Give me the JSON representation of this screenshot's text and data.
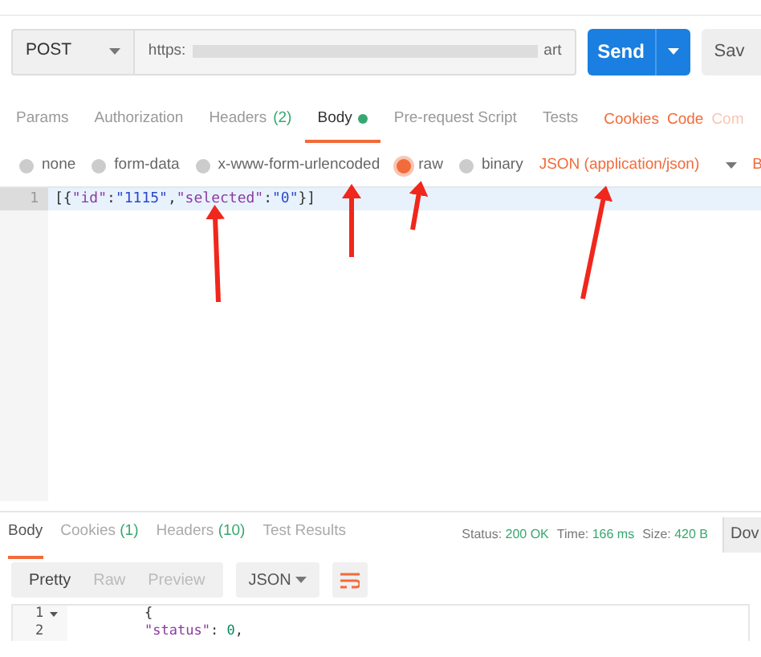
{
  "request": {
    "method": "POST",
    "url_start": "https:",
    "url_end": "art",
    "send": "Send",
    "save": "Sav"
  },
  "tabs": [
    {
      "label": "Params",
      "selected": false,
      "dot": false
    },
    {
      "label": "Authorization",
      "selected": false,
      "dot": false
    },
    {
      "label": "Headers",
      "count": "(2)",
      "selected": false,
      "dot": false
    },
    {
      "label": "Body",
      "selected": true,
      "dot": true
    },
    {
      "label": "Pre-request Script",
      "selected": false,
      "dot": false
    },
    {
      "label": "Tests",
      "selected": false,
      "dot": false
    }
  ],
  "links": [
    {
      "label": "Cookies",
      "disabled": false
    },
    {
      "label": "Code",
      "disabled": false
    },
    {
      "label": "Com",
      "disabled": true
    }
  ],
  "body_types": [
    {
      "label": "none",
      "selected": false
    },
    {
      "label": "form-data",
      "selected": false
    },
    {
      "label": "x-www-form-urlencoded",
      "selected": false
    },
    {
      "label": "raw",
      "selected": true
    },
    {
      "label": "binary",
      "selected": false
    }
  ],
  "content_type": "JSON (application/json)",
  "beautify": "B",
  "editor": [
    {
      "number": "1",
      "tokens": [
        {
          "kind": "punct",
          "text": "[{"
        },
        {
          "kind": "key",
          "text": "\"id\""
        },
        {
          "kind": "punct",
          "text": ":"
        },
        {
          "kind": "string",
          "text": "\"1115\""
        },
        {
          "kind": "punct",
          "text": ","
        },
        {
          "kind": "key",
          "text": "\"selected\""
        },
        {
          "kind": "punct",
          "text": ":"
        },
        {
          "kind": "string",
          "text": "\"0\""
        },
        {
          "kind": "punct",
          "text": "}]"
        }
      ]
    }
  ],
  "response": {
    "tabs": [
      {
        "label": "Body",
        "selected": true
      },
      {
        "label": "Cookies",
        "count": "(1)",
        "selected": false
      },
      {
        "label": "Headers",
        "count": "(10)",
        "selected": false
      },
      {
        "label": "Test Results",
        "selected": false
      }
    ],
    "stats": [
      {
        "label": "Status:",
        "value": "200 OK"
      },
      {
        "label": "Time:",
        "value": "166 ms"
      },
      {
        "label": "Size:",
        "value": "420 B"
      }
    ],
    "download": "Dov",
    "views": [
      {
        "label": "Pretty",
        "selected": true
      },
      {
        "label": "Raw",
        "selected": false
      },
      {
        "label": "Preview",
        "selected": false
      }
    ],
    "format": "JSON",
    "lines": [
      {
        "number": "1",
        "fold": true,
        "tokens": [
          {
            "kind": "punct",
            "text": "{"
          }
        ]
      },
      {
        "number": "2",
        "fold": false,
        "tokens": [
          {
            "kind": "key",
            "text": "\"status\""
          },
          {
            "kind": "punct",
            "text": ": "
          },
          {
            "kind": "number",
            "text": "0"
          },
          {
            "kind": "punct",
            "text": ","
          }
        ]
      }
    ]
  }
}
